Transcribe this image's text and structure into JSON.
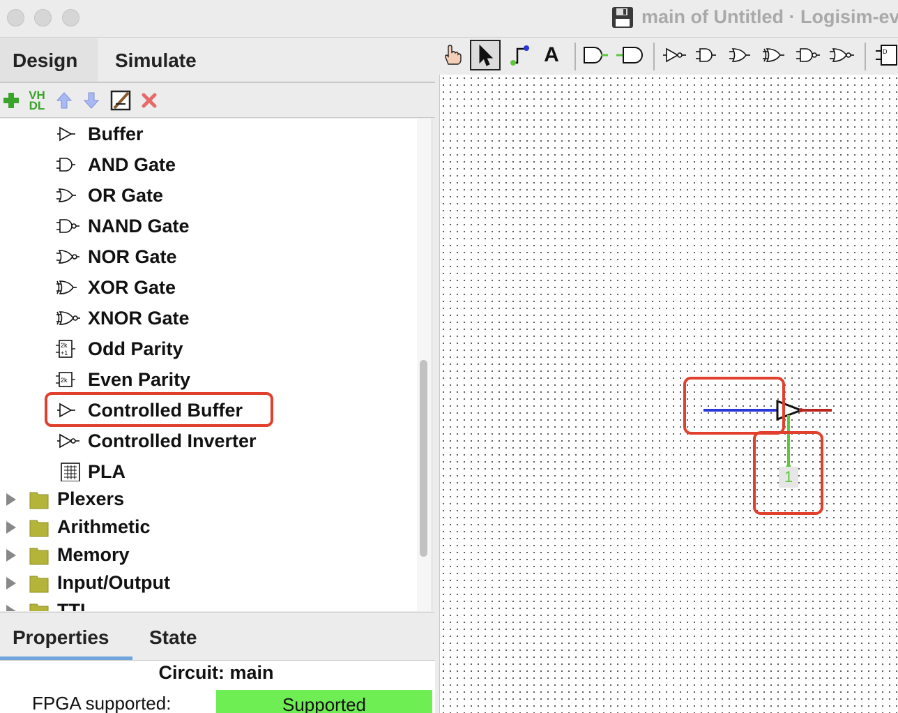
{
  "window": {
    "title": "main of Untitled · Logisim-evolution"
  },
  "left_tabs": {
    "design": "Design",
    "simulate": "Simulate"
  },
  "toolbox": {
    "vhdl_label_line1": "VH",
    "vhdl_label_line2": "DL"
  },
  "components": [
    {
      "label": "Buffer",
      "icon": "buffer-icon"
    },
    {
      "label": "AND Gate",
      "icon": "and-gate-icon"
    },
    {
      "label": "OR Gate",
      "icon": "or-gate-icon"
    },
    {
      "label": "NAND Gate",
      "icon": "nand-gate-icon"
    },
    {
      "label": "NOR Gate",
      "icon": "nor-gate-icon"
    },
    {
      "label": "XOR Gate",
      "icon": "xor-gate-icon"
    },
    {
      "label": "XNOR Gate",
      "icon": "xnor-gate-icon"
    },
    {
      "label": "Odd Parity",
      "icon": "odd-parity-icon"
    },
    {
      "label": "Even Parity",
      "icon": "even-parity-icon"
    },
    {
      "label": "Controlled Buffer",
      "icon": "controlled-buffer-icon",
      "selected": true
    },
    {
      "label": "Controlled Inverter",
      "icon": "controlled-inverter-icon"
    },
    {
      "label": "PLA",
      "icon": "pla-icon"
    }
  ],
  "folders": [
    {
      "label": "Plexers"
    },
    {
      "label": "Arithmetic"
    },
    {
      "label": "Memory"
    },
    {
      "label": "Input/Output"
    },
    {
      "label": "TTL"
    }
  ],
  "bottom_tabs": {
    "properties": "Properties",
    "state": "State"
  },
  "properties": {
    "circuit_title": "Circuit: main",
    "fpga_label": "FPGA supported:",
    "fpga_value": "Supported"
  },
  "canvas": {
    "control_pin_value": "1"
  },
  "colors": {
    "highlight": "#e0402c",
    "wire_blue": "#2a36d8",
    "wire_green": "#5cc83a",
    "wire_red": "#b8261e",
    "supported_bg": "#6fee54"
  }
}
